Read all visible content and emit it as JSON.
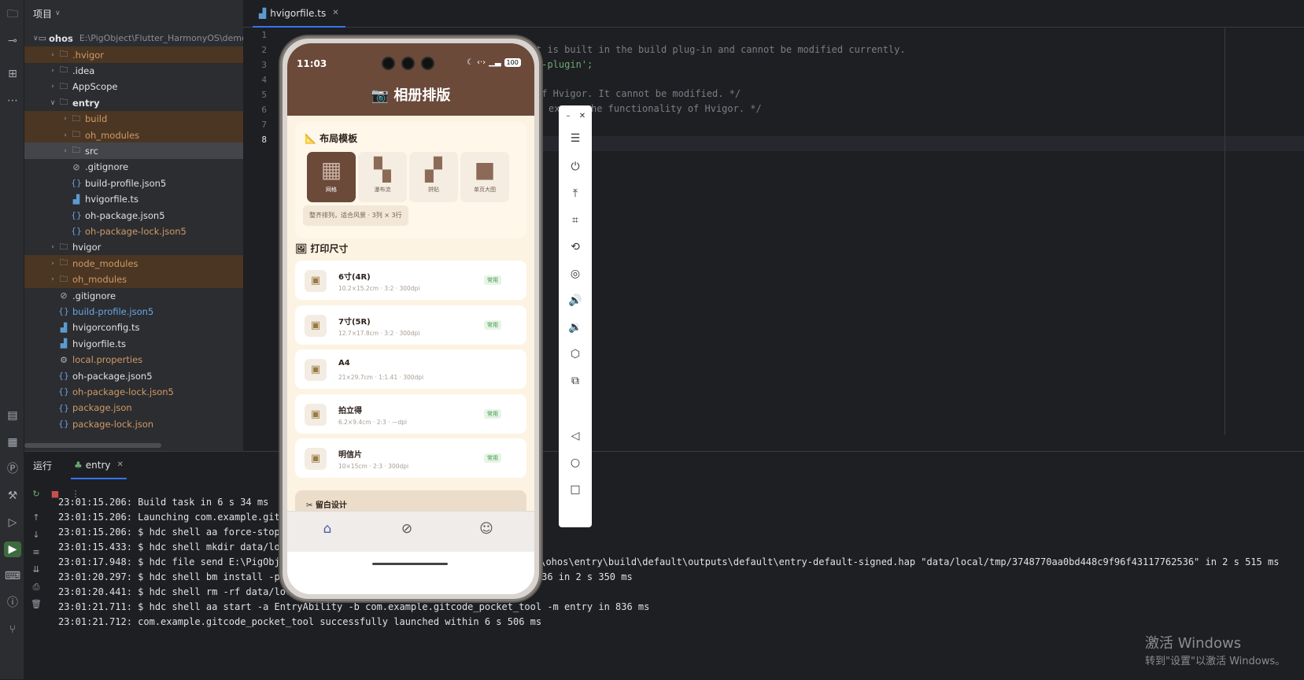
{
  "project": {
    "title": "项目",
    "root": "ohos",
    "root_path": "E:\\PigObject\\Flutter_HarmonyOS\\demo\\g",
    "items": [
      {
        "label": ".hvigor",
        "icon": "folder-icon"
      },
      {
        "label": ".idea",
        "icon": "folder-icon"
      },
      {
        "label": "AppScope",
        "icon": "folder-icon"
      },
      {
        "label": "entry",
        "icon": "module-folder-icon"
      },
      {
        "label": "build",
        "icon": "folder-icon"
      },
      {
        "label": "oh_modules",
        "icon": "folder-icon"
      },
      {
        "label": "src",
        "icon": "folder-icon"
      },
      {
        "label": ".gitignore",
        "icon": "ignore-file-icon"
      },
      {
        "label": "build-profile.json5",
        "icon": "json-file-icon"
      },
      {
        "label": "hvigorfile.ts",
        "icon": "ts-file-icon"
      },
      {
        "label": "oh-package.json5",
        "icon": "json-file-icon"
      },
      {
        "label": "oh-package-lock.json5",
        "icon": "json-file-icon"
      },
      {
        "label": "hvigor",
        "icon": "folder-icon"
      },
      {
        "label": "node_modules",
        "icon": "folder-icon"
      },
      {
        "label": "oh_modules",
        "icon": "folder-icon"
      },
      {
        "label": ".gitignore",
        "icon": "ignore-file-icon"
      },
      {
        "label": "build-profile.json5",
        "icon": "json-file-icon"
      },
      {
        "label": "hvigorconfig.ts",
        "icon": "ts-file-icon"
      },
      {
        "label": "hvigorfile.ts",
        "icon": "ts-file-icon"
      },
      {
        "label": "local.properties",
        "icon": "settings-file-icon"
      },
      {
        "label": "oh-package.json5",
        "icon": "json-file-icon"
      },
      {
        "label": "oh-package-lock.json5",
        "icon": "json-file-icon"
      },
      {
        "label": "package.json",
        "icon": "json-file-icon"
      },
      {
        "label": "package-lock.json",
        "icon": "json-file-icon"
      }
    ]
  },
  "editor": {
    "tab": "hvigorfile.ts",
    "line_numbers": [
      "1",
      "2",
      "3",
      "4",
      "5",
      "6",
      "7",
      "8"
    ],
    "code_lines": [
      "t is built in the build plug-in and cannot be modified currently.",
      "s-plugin';",
      "of Hvigor. It cannot be modified. */",
      "ex",
      "he functionality of Hvigor. */"
    ]
  },
  "run": {
    "label": "运行",
    "tab": "entry",
    "logs": [
      "23:01:15.206: Build task in 6 s 34 ms",
      "23:01:15.206: Launching com.example.git",
      "23:01:15.206: $ hdc shell aa force-stop",
      "23:01:15.433: $ hdc shell mkdir data/lo",
      "23:01:17.948: $ hdc file send E:\\PigObje",
      "23:01:20.297: $ hdc shell bm install -p data/local/tmp/3748770aa0bd448c9f96f43117762536 in 2 s 350 ms",
      "23:01:20.441: $ hdc shell rm -rf data/local/tmp/3748770aa0bd448c9f96f43117762536",
      "23:01:21.711: $ hdc shell aa start -a EntryAbility -b com.example.gitcode_pocket_tool -m entry in 836 ms",
      "23:01:21.712: com.example.gitcode_pocket_tool successfully launched within 6 s 506 ms"
    ],
    "log_tail": "l\\ohos\\entry\\build\\default\\outputs\\default\\entry-default-signed.hap \"data/local/tmp/3748770aa0bd448c9f96f43117762536\" in 2 s 515 ms"
  },
  "watermark": {
    "line1": "激活 Windows",
    "line2": "转到\"设置\"以激活 Windows。"
  },
  "phone": {
    "time": "11:03",
    "battery": "100",
    "title": "📷 相册排版",
    "layout_section": "📐 布局模板",
    "templates": [
      {
        "label": "网格",
        "active": true
      },
      {
        "label": "瀑布流",
        "active": false
      },
      {
        "label": "拼贴",
        "active": false
      },
      {
        "label": "单页大图",
        "active": false
      }
    ],
    "template_desc": "整齐排列，适合风景 · 3列 × 3行",
    "size_section": "🖼 打印尺寸",
    "sizes": [
      {
        "name": "6寸(4R)",
        "meta": "10.2×15.2cm · 3:2 · 300dpi",
        "badge": "常用"
      },
      {
        "name": "7寸(5R)",
        "meta": "12.7×17.8cm · 3:2 · 300dpi",
        "badge": "常用"
      },
      {
        "name": "A4",
        "meta": "21×29.7cm · 1:1.41 · 300dpi",
        "badge": ""
      },
      {
        "name": "拍立得",
        "meta": "6.2×9.4cm · 2:3 · —dpi",
        "badge": "常用"
      },
      {
        "name": "明信片",
        "meta": "10×15cm · 2:3 · 300dpi",
        "badge": "常用"
      }
    ],
    "margin_section": "✂ 留白设计"
  },
  "colors": {
    "brand": "#6b4a3a",
    "background": "#fdf3e2",
    "badge": "#3a9b4c"
  }
}
